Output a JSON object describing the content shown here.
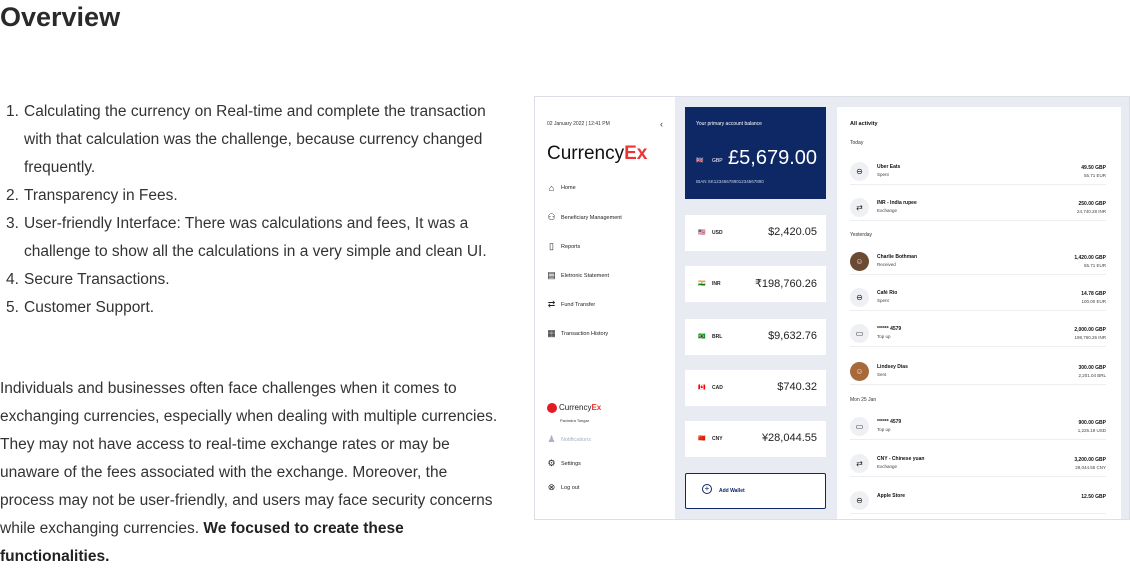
{
  "article": {
    "title": "Overview",
    "challenges": [
      {
        "num": "1.",
        "text": "Calculating the currency on Real-time and complete the transaction with that calculation was the challenge, because currency changed frequently."
      },
      {
        "num": "2.",
        "text": "Transparency in Fees."
      },
      {
        "num": "3.",
        "text": "User-friendly Interface: There was calculations and fees, It was a challenge to show all the calculations in a very simple and clean UI."
      },
      {
        "num": "4.",
        "text": "Secure Transactions."
      },
      {
        "num": "5.",
        "text": "Customer Support."
      }
    ],
    "description": "Individuals and businesses often face challenges when it comes to exchanging currencies, especially when dealing with multiple currencies. They may not have access to real-time exchange rates or may be unaware of the fees associated with the exchange. Moreover, the process may not be user-friendly, and users may face security concerns while exchanging currencies. ",
    "description_bold": "We focused to create these functionalities."
  },
  "app": {
    "sidebar": {
      "datetime": "02 January 2022  |  12:41 PM",
      "collapse_icon": "‹",
      "brand_main": "Currency",
      "brand_accent": "Ex",
      "nav": [
        {
          "icon": "⌂",
          "label": "Home"
        },
        {
          "icon": "⚇",
          "label": "Beneficiary Management"
        },
        {
          "icon": "▯",
          "label": "Reports"
        },
        {
          "icon": "▤",
          "label": "Eletronic Statement"
        },
        {
          "icon": "⇄",
          "label": "Fund Transfer"
        },
        {
          "icon": "▦",
          "label": "Transaction History"
        }
      ],
      "profile_brand_main": "Currency",
      "profile_brand_accent": "Ex",
      "profile_name": "Pavindra Tongar",
      "bottom_nav": [
        {
          "icon": "♟",
          "label": "Notifications",
          "muted": true
        },
        {
          "icon": "⚙",
          "label": "Settings",
          "muted": false
        },
        {
          "icon": "⊗",
          "label": "Log out",
          "muted": false
        }
      ]
    },
    "primary_wallet": {
      "label": "Your primary account balance",
      "flag": "🇬🇧",
      "currency": "GBP",
      "amount": "£5,679.00",
      "iban": "IBAN SK12345678901234567890"
    },
    "wallets": [
      {
        "flag": "🇺🇸",
        "currency": "USD",
        "amount": "$2,420.05"
      },
      {
        "flag": "🇮🇳",
        "currency": "INR",
        "amount": "₹198,760.26"
      },
      {
        "flag": "🇧🇷",
        "currency": "BRL",
        "amount": "$9,632.76"
      },
      {
        "flag": "🇨🇦",
        "currency": "CAD",
        "amount": "$740.32"
      },
      {
        "flag": "🇨🇳",
        "currency": "CNY",
        "amount": "¥28,044.55"
      }
    ],
    "add_wallet_label": "Add Wallet",
    "activity": {
      "title": "All activity",
      "groups": [
        {
          "label": "Today"
        },
        {
          "label": "Yesterday"
        },
        {
          "label": "Mon 25 Jan"
        }
      ],
      "transactions": [
        {
          "icon": "⊖",
          "name": "Uber Eats",
          "kind": "Spent",
          "amount": "49.50 GBP",
          "converted": "55.71 EUR"
        },
        {
          "icon": "⇄",
          "name": "INR - India rupee",
          "kind": "Exchange",
          "amount": "250.00 GBP",
          "converted": "24,740.28 INR"
        },
        {
          "icon": "☺",
          "name": "Charlie Bothman",
          "kind": "Received",
          "amount": "1,420.00 GBP",
          "converted": "55.71 EUR"
        },
        {
          "icon": "⊖",
          "name": "Café Rio",
          "kind": "Spent",
          "amount": "14.78 GBP",
          "converted": "100.00 EUR"
        },
        {
          "icon": "▭",
          "name": "****** 4579",
          "kind": "Top up",
          "amount": "2,000.00 GBP",
          "converted": "198,760.26 INR"
        },
        {
          "icon": "☺",
          "name": "Lindsey Dias",
          "kind": "Sent",
          "amount": "300.00 GBP",
          "converted": "2,201.04 BRL"
        },
        {
          "icon": "▭",
          "name": "****** 4579",
          "kind": "Top up",
          "amount": "900.00 GBP",
          "converted": "1,225.19 USD"
        },
        {
          "icon": "⇄",
          "name": "CNY - Chinese yuan",
          "kind": "Exchange",
          "amount": "3,200.00 GBP",
          "converted": "28,044.55 CNY"
        },
        {
          "icon": "⊖",
          "name": "Apple Store",
          "kind": "",
          "amount": "12.50 GBP",
          "converted": ""
        }
      ]
    }
  }
}
